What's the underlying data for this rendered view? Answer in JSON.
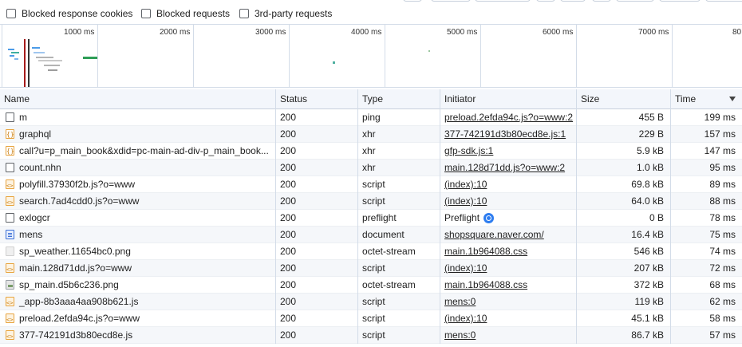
{
  "filters": {
    "blocked_cookies": "Blocked response cookies",
    "blocked_requests": "Blocked requests",
    "third_party": "3rd-party requests"
  },
  "overview": {
    "ticks": [
      "1000 ms",
      "2000 ms",
      "3000 ms",
      "4000 ms",
      "5000 ms",
      "6000 ms",
      "7000 ms",
      "80"
    ]
  },
  "columns": {
    "name": "Name",
    "status": "Status",
    "type": "Type",
    "initiator": "Initiator",
    "size": "Size",
    "time": "Time"
  },
  "rows": [
    {
      "icon": "plain",
      "name": "m",
      "status": "200",
      "type": "ping",
      "initiator": "preload.2efda94c.js?o=www:2",
      "link": true,
      "size": "455 B",
      "time": "199 ms"
    },
    {
      "icon": "xhr",
      "name": "graphql",
      "status": "200",
      "type": "xhr",
      "initiator": "377-742191d3b80ecd8e.js:1",
      "link": true,
      "size": "229 B",
      "time": "157 ms"
    },
    {
      "icon": "xhr",
      "name": "call?u=p_main_book&xdid=pc-main-ad-div-p_main_book...",
      "status": "200",
      "type": "xhr",
      "initiator": "gfp-sdk.js:1",
      "link": true,
      "size": "5.9 kB",
      "time": "147 ms"
    },
    {
      "icon": "plain",
      "name": "count.nhn",
      "status": "200",
      "type": "xhr",
      "initiator": "main.128d71dd.js?o=www:2",
      "link": true,
      "size": "1.0 kB",
      "time": "95 ms"
    },
    {
      "icon": "script",
      "name": "polyfill.37930f2b.js?o=www",
      "status": "200",
      "type": "script",
      "initiator": "(index):10",
      "link": true,
      "size": "69.8 kB",
      "time": "89 ms"
    },
    {
      "icon": "script",
      "name": "search.7ad4cdd0.js?o=www",
      "status": "200",
      "type": "script",
      "initiator": "(index):10",
      "link": true,
      "size": "64.0 kB",
      "time": "88 ms"
    },
    {
      "icon": "plain",
      "name": "exlogcr",
      "status": "200",
      "type": "preflight",
      "initiator": "Preflight",
      "link": false,
      "preflight": true,
      "size": "0 B",
      "time": "78 ms"
    },
    {
      "icon": "document",
      "name": "mens",
      "status": "200",
      "type": "document",
      "initiator": "shopsquare.naver.com/",
      "link": true,
      "size": "16.4 kB",
      "time": "75 ms"
    },
    {
      "icon": "image-light",
      "name": "sp_weather.11654bc0.png",
      "status": "200",
      "type": "octet-stream",
      "initiator": "main.1b964088.css",
      "link": true,
      "size": "546 kB",
      "time": "74 ms"
    },
    {
      "icon": "script",
      "name": "main.128d71dd.js?o=www",
      "status": "200",
      "type": "script",
      "initiator": "(index):10",
      "link": true,
      "size": "207 kB",
      "time": "72 ms"
    },
    {
      "icon": "image",
      "name": "sp_main.d5b6c236.png",
      "status": "200",
      "type": "octet-stream",
      "initiator": "main.1b964088.css",
      "link": true,
      "size": "372 kB",
      "time": "68 ms"
    },
    {
      "icon": "script",
      "name": "_app-8b3aaa4aa908b621.js",
      "status": "200",
      "type": "script",
      "initiator": "mens:0",
      "link": true,
      "size": "119 kB",
      "time": "62 ms"
    },
    {
      "icon": "script",
      "name": "preload.2efda94c.js?o=www",
      "status": "200",
      "type": "script",
      "initiator": "(index):10",
      "link": true,
      "size": "45.1 kB",
      "time": "58 ms"
    },
    {
      "icon": "script",
      "name": "377-742191d3b80ecd8e.js",
      "status": "200",
      "type": "script",
      "initiator": "mens:0",
      "link": true,
      "size": "86.7 kB",
      "time": "57 ms"
    }
  ],
  "colors": {
    "header_bg": "#f3f6fb",
    "alt_row_bg": "#f5f7fa",
    "grid_line": "#d3dce8",
    "preflight_icon": "#2e7df0"
  }
}
